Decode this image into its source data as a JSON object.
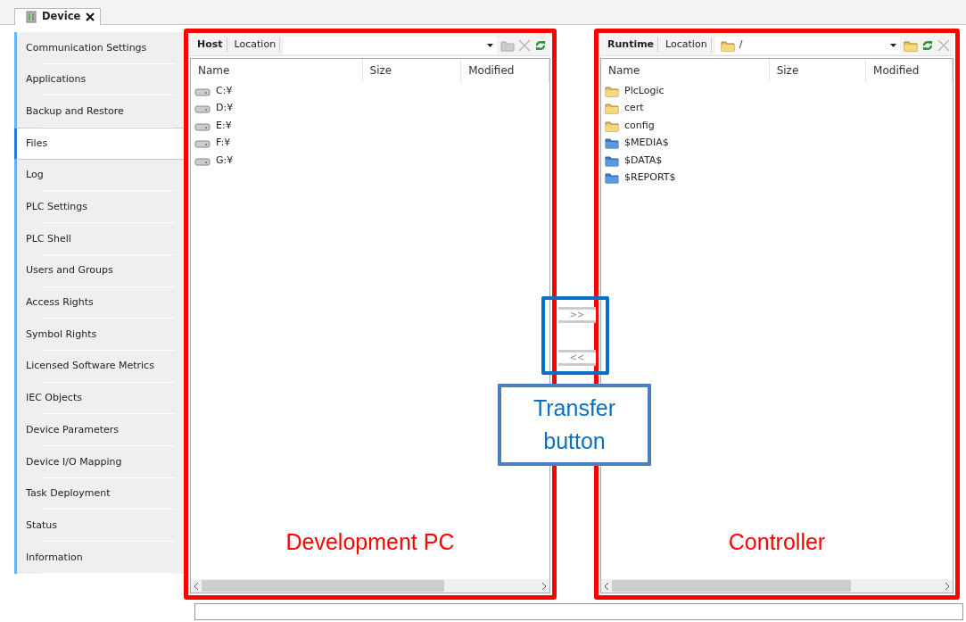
{
  "tab": {
    "title": "Device"
  },
  "sidebar": {
    "items": [
      {
        "label": "Communication Settings",
        "selected": false
      },
      {
        "label": "Applications",
        "selected": false
      },
      {
        "label": "Backup and Restore",
        "selected": false
      },
      {
        "label": "Files",
        "selected": true
      },
      {
        "label": "Log",
        "selected": false
      },
      {
        "label": "PLC Settings",
        "selected": false
      },
      {
        "label": "PLC Shell",
        "selected": false
      },
      {
        "label": "Users and Groups",
        "selected": false
      },
      {
        "label": "Access Rights",
        "selected": false
      },
      {
        "label": "Symbol Rights",
        "selected": false
      },
      {
        "label": "Licensed Software Metrics",
        "selected": false
      },
      {
        "label": "IEC Objects",
        "selected": false
      },
      {
        "label": "Device Parameters",
        "selected": false
      },
      {
        "label": "Device I/O Mapping",
        "selected": false
      },
      {
        "label": "Task Deployment",
        "selected": false
      },
      {
        "label": "Status",
        "selected": false
      },
      {
        "label": "Information",
        "selected": false
      }
    ]
  },
  "panels": [
    {
      "label": "Host",
      "location_label": "Location",
      "path_icon": false,
      "tools": [
        {
          "kind": "new-folder",
          "disabled": true
        },
        {
          "kind": "delete",
          "disabled": true
        },
        {
          "kind": "refresh",
          "disabled": false
        }
      ],
      "columns": [
        "Name",
        "Size",
        "Modified"
      ],
      "items": [
        {
          "name": "C:¥",
          "kind": "drive"
        },
        {
          "name": "D:¥",
          "kind": "drive"
        },
        {
          "name": "E:¥",
          "kind": "drive"
        },
        {
          "name": "F:¥",
          "kind": "drive"
        },
        {
          "name": "G:¥",
          "kind": "drive"
        }
      ],
      "annotation": "Development PC"
    },
    {
      "label": "Runtime",
      "location_label": "Location",
      "path": "/",
      "path_icon": true,
      "tools": [
        {
          "kind": "new-folder",
          "disabled": false
        },
        {
          "kind": "refresh",
          "disabled": false
        },
        {
          "kind": "delete",
          "disabled": true
        }
      ],
      "columns": [
        "Name",
        "Size",
        "Modified"
      ],
      "items": [
        {
          "name": "PlcLogic",
          "kind": "folder"
        },
        {
          "name": "cert",
          "kind": "folder"
        },
        {
          "name": "config",
          "kind": "folder"
        },
        {
          "name": "$MEDIA$",
          "kind": "special-folder"
        },
        {
          "name": "$DATA$",
          "kind": "special-folder"
        },
        {
          "name": "$REPORT$",
          "kind": "special-folder"
        }
      ],
      "annotation": "Controller"
    }
  ],
  "transfer": {
    "buttons": [
      ">>",
      "<<"
    ],
    "callout": "Transfer button"
  }
}
